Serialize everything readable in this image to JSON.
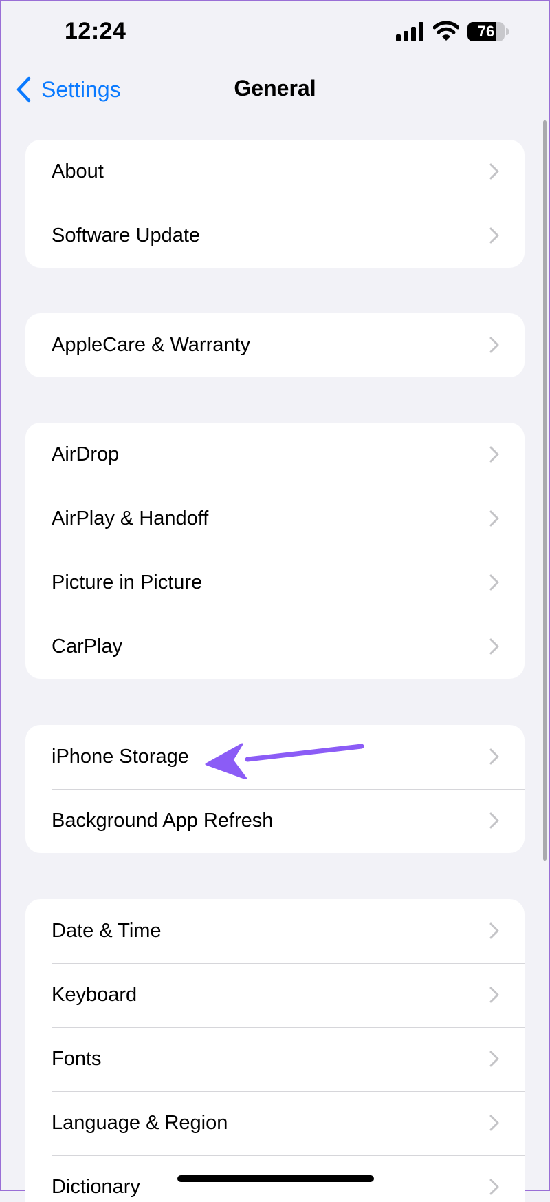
{
  "status_bar": {
    "time": "12:24",
    "battery_level": "76",
    "battery_fraction": 0.76
  },
  "nav": {
    "back_label": "Settings",
    "title": "General"
  },
  "groups": [
    {
      "items": [
        "About",
        "Software Update"
      ]
    },
    {
      "items": [
        "AppleCare & Warranty"
      ]
    },
    {
      "items": [
        "AirDrop",
        "AirPlay & Handoff",
        "Picture in Picture",
        "CarPlay"
      ]
    },
    {
      "items": [
        "iPhone Storage",
        "Background App Refresh"
      ]
    },
    {
      "items": [
        "Date & Time",
        "Keyboard",
        "Fonts",
        "Language & Region",
        "Dictionary"
      ]
    }
  ],
  "colors": {
    "accent": "#0a7aff",
    "background": "#f2f2f7",
    "annotation": "#8b5cf6",
    "separator": "#d6d6da",
    "chevron": "#c4c4c7"
  },
  "icons": {
    "back": "chevron-left-icon",
    "row": "chevron-right-icon",
    "annotation": "arrow-left-icon"
  }
}
